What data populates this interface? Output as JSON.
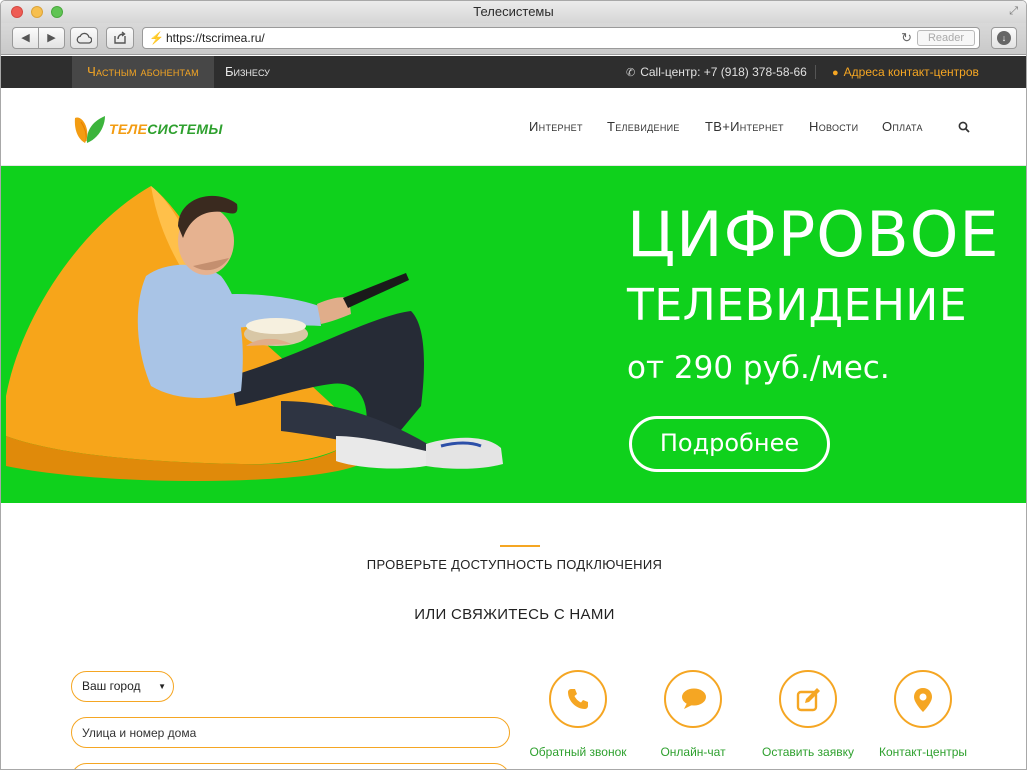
{
  "browser": {
    "window_title": "Телесистемы",
    "url": "https://tscrimea.ru/",
    "reader_label": "Reader"
  },
  "topbar": {
    "segment_private": "Частным абонентам",
    "segment_business": "Бизнесу",
    "callcenter": "Call-центр: +7 (918) 378-58-66",
    "contact_centers_link": "Адреса контакт-центров"
  },
  "header": {
    "logo_part1": "ТЕЛЕ",
    "logo_part2": "СИСТЕМЫ",
    "nav": {
      "internet": "Интернет",
      "tv": "Телевидение",
      "tv_internet": "ТВ+Интернет",
      "news": "Новости",
      "payment": "Оплата"
    }
  },
  "hero": {
    "title_line1": "ЦИФРОВОЕ",
    "title_line2": "ТЕЛЕВИДЕНИЕ",
    "price": "от 290 руб./мес.",
    "button": "Подробнее"
  },
  "availability": {
    "title": "ПРОВЕРЬТЕ ДОСТУПНОСТЬ ПОДКЛЮЧЕНИЯ",
    "contact_title": "ИЛИ СВЯЖИТЕСЬ С НАМИ",
    "city_select_value": "Ваш город",
    "street_placeholder": "Улица и номер дома"
  },
  "contacts": [
    {
      "label": "Обратный звонок",
      "icon": "phone-icon"
    },
    {
      "label": "Онлайн-чат",
      "icon": "chat-icon"
    },
    {
      "label": "Оставить заявку",
      "icon": "edit-icon"
    },
    {
      "label": "Контакт-центры",
      "icon": "map-pin-icon"
    }
  ],
  "colors": {
    "hero_green": "#0fd11c",
    "accent_orange": "#f5a623",
    "brand_green": "#2ea02e",
    "topbar_dark": "#2e2e2e"
  }
}
